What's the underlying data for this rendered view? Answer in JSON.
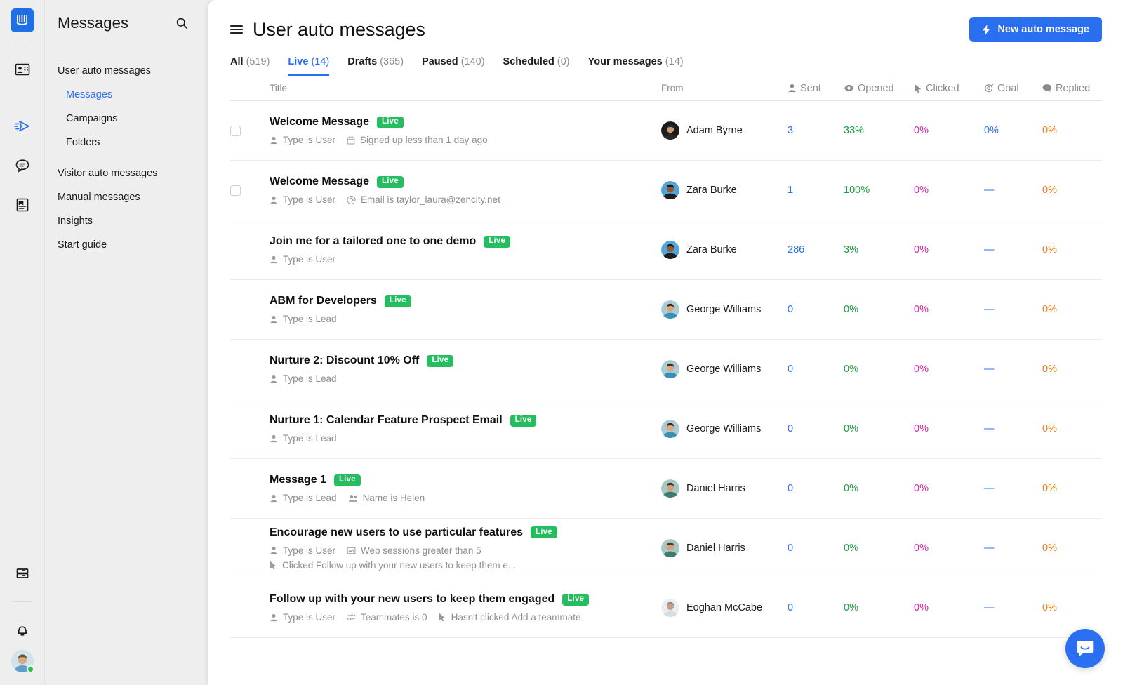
{
  "rail": {
    "logo_icon": "intercom-logo-icon",
    "icons": [
      {
        "name": "contacts-icon"
      },
      {
        "name": "outbound-send-icon",
        "active": true
      },
      {
        "name": "inbox-conversation-icon"
      },
      {
        "name": "articles-icon"
      },
      {
        "name": "reports-icon"
      },
      {
        "name": "notifications-bell-icon"
      }
    ]
  },
  "sidebar": {
    "title": "Messages",
    "search_icon": "search-icon",
    "groups": [
      {
        "label": "User auto messages",
        "children": [
          {
            "label": "Messages",
            "active": true
          },
          {
            "label": "Campaigns",
            "active": false
          },
          {
            "label": "Folders",
            "active": false
          }
        ]
      }
    ],
    "items": [
      {
        "label": "Visitor auto messages"
      },
      {
        "label": "Manual messages"
      },
      {
        "label": "Insights"
      },
      {
        "label": "Start guide"
      }
    ]
  },
  "header": {
    "menu_icon": "hamburger-menu-icon",
    "title": "User auto messages",
    "new_button_label": "New auto message",
    "new_button_icon": "lightning-bolt-icon",
    "accent_color": "#2a6ff0"
  },
  "tabs": [
    {
      "label": "All",
      "count": "(519)",
      "active": false
    },
    {
      "label": "Live",
      "count": "(14)",
      "active": true
    },
    {
      "label": "Drafts",
      "count": "(365)",
      "active": false
    },
    {
      "label": "Paused",
      "count": "(140)",
      "active": false
    },
    {
      "label": "Scheduled",
      "count": "(0)",
      "active": false
    },
    {
      "label": "Your messages",
      "count": "(14)",
      "active": false
    }
  ],
  "table": {
    "columns": [
      {
        "key": "title",
        "label": "Title",
        "icon": null
      },
      {
        "key": "from",
        "label": "From",
        "icon": null
      },
      {
        "key": "sent",
        "label": "Sent",
        "icon": "person-icon"
      },
      {
        "key": "opened",
        "label": "Opened",
        "icon": "eye-icon"
      },
      {
        "key": "clicked",
        "label": "Clicked",
        "icon": "cursor-arrow-icon"
      },
      {
        "key": "goal",
        "label": "Goal",
        "icon": "target-icon"
      },
      {
        "key": "replied",
        "label": "Replied",
        "icon": "speech-bubble-icon"
      }
    ],
    "rows": [
      {
        "title": "Welcome Message",
        "status": "Live",
        "checkbox": true,
        "meta": [
          [
            {
              "icon": "person-icon",
              "text": "Type is User"
            },
            {
              "icon": "calendar-icon",
              "text": "Signed up less than 1 day ago"
            }
          ]
        ],
        "from": "Adam Byrne",
        "avatar": "adam",
        "sent": "3",
        "opened": "33%",
        "clicked": "0%",
        "goal": "0%",
        "replied": "0%"
      },
      {
        "title": "Welcome Message",
        "status": "Live",
        "checkbox": true,
        "meta": [
          [
            {
              "icon": "person-icon",
              "text": "Type is User"
            },
            {
              "icon": "at-sign-icon",
              "text": "Email is taylor_laura@zencity.net"
            }
          ]
        ],
        "from": "Zara Burke",
        "avatar": "zara",
        "sent": "1",
        "opened": "100%",
        "clicked": "0%",
        "goal": "—",
        "replied": "0%"
      },
      {
        "title": "Join me for a tailored one to one demo",
        "status": "Live",
        "checkbox": false,
        "meta": [
          [
            {
              "icon": "person-icon",
              "text": "Type is User"
            }
          ]
        ],
        "from": "Zara Burke",
        "avatar": "zara",
        "sent": "286",
        "opened": "3%",
        "clicked": "0%",
        "goal": "—",
        "replied": "0%"
      },
      {
        "title": "ABM for Developers",
        "status": "Live",
        "checkbox": false,
        "meta": [
          [
            {
              "icon": "person-icon",
              "text": "Type is Lead"
            }
          ]
        ],
        "from": "George Williams",
        "avatar": "george",
        "sent": "0",
        "opened": "0%",
        "clicked": "0%",
        "goal": "—",
        "replied": "0%"
      },
      {
        "title": "Nurture 2: Discount 10% Off",
        "status": "Live",
        "checkbox": false,
        "meta": [
          [
            {
              "icon": "person-icon",
              "text": "Type is Lead"
            }
          ]
        ],
        "from": "George Williams",
        "avatar": "george",
        "sent": "0",
        "opened": "0%",
        "clicked": "0%",
        "goal": "—",
        "replied": "0%"
      },
      {
        "title": "Nurture 1: Calendar Feature Prospect Email",
        "status": "Live",
        "checkbox": false,
        "meta": [
          [
            {
              "icon": "person-icon",
              "text": "Type is Lead"
            }
          ]
        ],
        "from": "George Williams",
        "avatar": "george",
        "sent": "0",
        "opened": "0%",
        "clicked": "0%",
        "goal": "—",
        "replied": "0%"
      },
      {
        "title": "Message 1",
        "status": "Live",
        "checkbox": false,
        "meta": [
          [
            {
              "icon": "person-icon",
              "text": "Type is Lead"
            },
            {
              "icon": "people-icon",
              "text": "Name is Helen"
            }
          ]
        ],
        "from": "Daniel Harris",
        "avatar": "daniel",
        "sent": "0",
        "opened": "0%",
        "clicked": "0%",
        "goal": "—",
        "replied": "0%"
      },
      {
        "title": "Encourage new users to use particular features",
        "status": "Live",
        "checkbox": false,
        "meta": [
          [
            {
              "icon": "person-icon",
              "text": "Type is User"
            },
            {
              "icon": "chart-icon",
              "text": "Web sessions greater than 5"
            }
          ],
          [
            {
              "icon": "cursor-arrow-icon",
              "text": "Clicked Follow up with your new users to keep them e..."
            }
          ]
        ],
        "from": "Daniel Harris",
        "avatar": "daniel",
        "sent": "0",
        "opened": "0%",
        "clicked": "0%",
        "goal": "—",
        "replied": "0%"
      },
      {
        "title": "Follow up with your new users to keep them engaged",
        "status": "Live",
        "checkbox": false,
        "meta": [
          [
            {
              "icon": "person-icon",
              "text": "Type is User"
            },
            {
              "icon": "teammates-icon",
              "text": "Teammates is 0"
            },
            {
              "icon": "cursor-arrow-icon",
              "text": "Hasn't clicked Add a teammate"
            }
          ]
        ],
        "from": "Eoghan McCabe",
        "avatar": "eoghan",
        "sent": "0",
        "opened": "0%",
        "clicked": "0%",
        "goal": "—",
        "replied": "0%"
      }
    ]
  },
  "chat_widget": {
    "icon": "intercom-chat-icon",
    "color": "#2a6ff0"
  },
  "colors": {
    "live_badge": "#24bd5f",
    "sent": "#2a6ff0",
    "opened": "#1a9e41",
    "clicked": "#d81fa8",
    "goal": "#2a6ff0",
    "replied": "#ef7e1b"
  }
}
